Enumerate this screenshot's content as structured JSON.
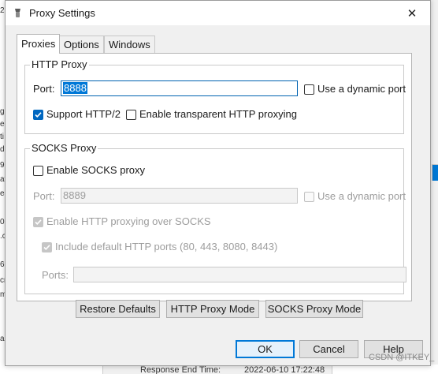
{
  "window": {
    "title": "Proxy Settings",
    "close_glyph": "✕"
  },
  "tabs": [
    {
      "label": "Proxies",
      "active": true
    },
    {
      "label": "Options",
      "active": false
    },
    {
      "label": "Windows",
      "active": false
    }
  ],
  "http_proxy": {
    "legend": "HTTP Proxy",
    "port_label": "Port:",
    "port_value": "8888",
    "dynamic_port_label": "Use a dynamic port",
    "dynamic_port_checked": false,
    "support_http2_label": "Support HTTP/2",
    "support_http2_checked": true,
    "transparent_label": "Enable transparent HTTP proxying",
    "transparent_checked": false
  },
  "socks_proxy": {
    "legend": "SOCKS Proxy",
    "enable_label": "Enable SOCKS proxy",
    "enable_checked": false,
    "port_label": "Port:",
    "port_value": "8889",
    "dynamic_port_label": "Use a dynamic port",
    "http_over_socks_label": "Enable HTTP proxying over SOCKS",
    "http_over_socks_checked": true,
    "include_ports_label": "Include default HTTP ports (80, 443, 8080, 8443)",
    "include_ports_checked": true,
    "ports_label": "Ports:",
    "ports_value": ""
  },
  "mode_buttons": {
    "restore": "Restore Defaults",
    "http_mode": "HTTP Proxy Mode",
    "socks_mode": "SOCKS Proxy Mode"
  },
  "footer_buttons": {
    "ok": "OK",
    "cancel": "Cancel",
    "help": "Help"
  },
  "background": {
    "left_fragments": [
      "2",
      "g",
      "ec",
      "ti",
      "d.",
      "9",
      "at",
      "ea",
      "0(",
      ".c",
      "6",
      "cr",
      "m",
      "a"
    ],
    "bottom_label": "Response End Time:",
    "bottom_value": "2022-06-10 17:22:48",
    "watermark": "CSDN @ITKEY_"
  },
  "colors": {
    "accent": "#0078d7",
    "checked_box": "#0067c0",
    "disabled_text": "#9d9d9d"
  }
}
